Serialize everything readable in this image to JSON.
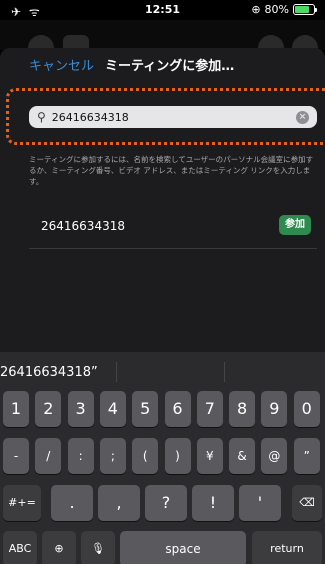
{
  "status": {
    "left_icons": "✈ ᯤ",
    "time": "12:51",
    "battery": "80%",
    "battery_icon": "⊕",
    "battery_level": 0.8
  },
  "sheet": {
    "cancel": "キャンセル",
    "title": "ミーティングに参加…",
    "search_value": "26416634318",
    "help": "ミーティングに参加するには、名前を検索してユーザーのパーソナル会議室に参加するか、ミーティング番号、ビデオ アドレス、またはミーティング リンクを入力します。",
    "result_number": "26416634318",
    "join_label": "参加"
  },
  "keyboard": {
    "suggestion": "26416634318”",
    "row1": [
      "1",
      "2",
      "3",
      "4",
      "5",
      "6",
      "7",
      "8",
      "9",
      "0"
    ],
    "row2": [
      "-",
      "/",
      ":",
      ";",
      "(",
      ")",
      "¥",
      "&",
      "@",
      "”"
    ],
    "row3_left": "#+=",
    "row3": [
      ".",
      ",",
      "?",
      "!",
      "'"
    ],
    "backspace": "⌫",
    "abc": "ABC",
    "globe": "⊕",
    "mic": "🎙",
    "space": "space",
    "return": "return"
  },
  "colors": {
    "accent": "#3a8bd9",
    "join": "#2e8a4f",
    "highlight": "#e8611a"
  }
}
